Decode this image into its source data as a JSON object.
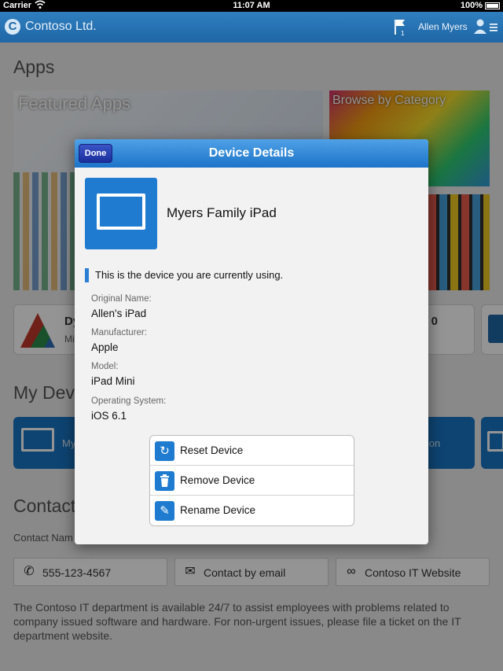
{
  "status_bar": {
    "carrier": "Carrier",
    "time": "11:07 AM",
    "battery": "100%"
  },
  "header": {
    "brand": "Contoso Ltd.",
    "flag_count": "1",
    "user_name": "Allen Myers"
  },
  "apps": {
    "title": "Apps",
    "featured_label": "Featured Apps",
    "category_label": "Browse by Category",
    "app_tile_1_title": "Dy",
    "app_tile_1_sub": "Mi",
    "app_tile_2_title": "0"
  },
  "devices": {
    "title": "My Dev",
    "tile_1_label": "My",
    "tile_2_label": "ation"
  },
  "contact": {
    "title": "Contact",
    "label": "Contact Nam",
    "phone": "555-123-4567",
    "email": "Contact by email",
    "website": "Contoso IT Website",
    "description": "The Contoso IT department is available 24/7 to assist employees with problems related to company issued software and hardware. For non-urgent issues, please file a ticket on the IT department website."
  },
  "modal": {
    "title": "Device Details",
    "done_label": "Done",
    "device_name": "Myers Family iPad",
    "current_note": "This is the device you are currently using.",
    "properties": [
      {
        "label": "Original Name:",
        "value": "Allen's iPad"
      },
      {
        "label": "Manufacturer:",
        "value": "Apple"
      },
      {
        "label": "Model:",
        "value": "iPad Mini"
      },
      {
        "label": "Operating System:",
        "value": "iOS 6.1"
      }
    ],
    "actions": [
      {
        "label": "Reset Device",
        "icon": "reset-icon"
      },
      {
        "label": "Remove Device",
        "icon": "trash-icon"
      },
      {
        "label": "Rename Device",
        "icon": "pencil-icon"
      }
    ]
  },
  "colors": {
    "header_blue": "#1f66a6",
    "accent_blue": "#1e7bd0",
    "done_button": "#1b2e9c"
  }
}
